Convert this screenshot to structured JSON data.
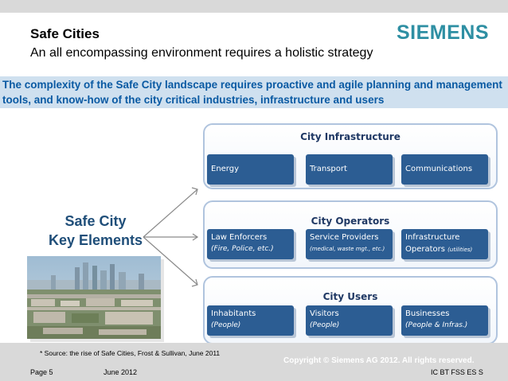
{
  "header": {
    "title": "Safe Cities",
    "subtitle": "An all encompassing environment requires a holistic strategy",
    "logo": "SIEMENS"
  },
  "banner": {
    "text": "The complexity of the Safe City landscape requires proactive and agile planning and management tools, and know-how of the city critical industries, infrastructure and users"
  },
  "key_elements": {
    "line1": "Safe City",
    "line2": "Key Elements"
  },
  "groups": [
    {
      "title": "City Infrastructure",
      "cards": [
        {
          "label": "Energy",
          "sub": ""
        },
        {
          "label": "Transport",
          "sub": ""
        },
        {
          "label": "Communications",
          "sub": ""
        }
      ]
    },
    {
      "title": "City Operators",
      "cards": [
        {
          "label": "Law Enforcers",
          "sub": "(Fire, Police, etc.)"
        },
        {
          "label": "Service Providers",
          "sub": "(medical, waste mgt., etc.)"
        },
        {
          "label": "Infrastructure",
          "sub_main": "Operators",
          "sub_small": "(utilities)"
        }
      ]
    },
    {
      "title": "City Users",
      "cards": [
        {
          "label": "Inhabitants",
          "sub": "(People)"
        },
        {
          "label": "Visitors",
          "sub": "(People)"
        },
        {
          "label": "Businesses",
          "sub": "(People & Infras.)"
        }
      ]
    }
  ],
  "footer": {
    "source": "* Source: the rise of Safe Cities, Frost & Sullivan, June 2011",
    "copyright": "Copyright © Siemens AG 2012. All rights reserved.",
    "page": "Page 5",
    "date": "June 2012",
    "department": "IC BT FSS ES S"
  },
  "colors": {
    "brand": "#2e8fa3",
    "banner_bg": "#cfe0ef",
    "banner_text": "#0a5aa3",
    "card": "#2c5d93",
    "key_text": "#1f4e79"
  }
}
